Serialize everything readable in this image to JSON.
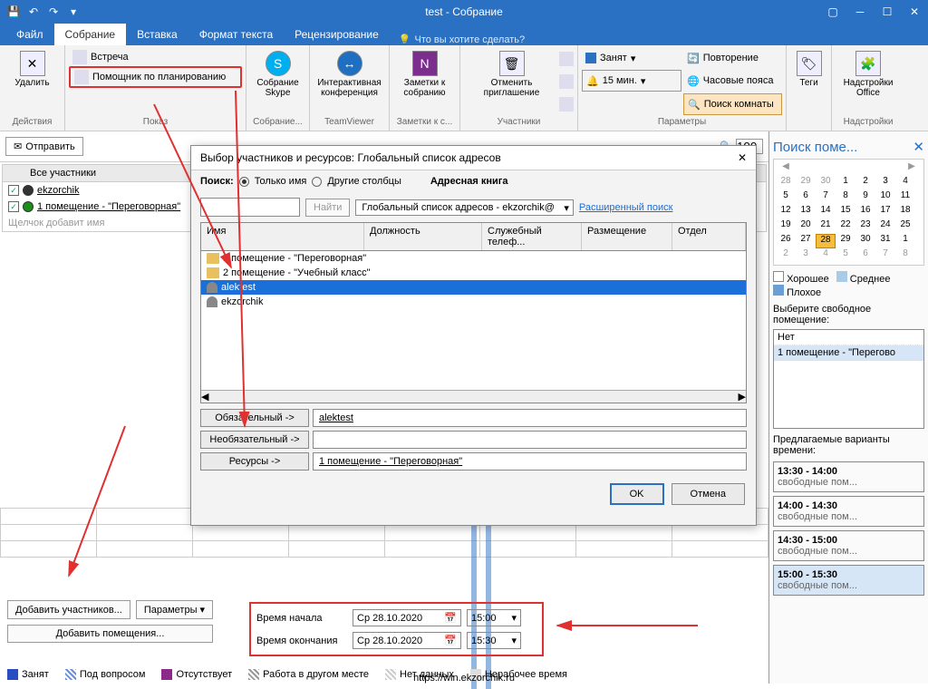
{
  "titlebar": {
    "app_title": "test - Собрание"
  },
  "tabs": {
    "file": "Файл",
    "meeting": "Собрание",
    "insert": "Вставка",
    "format": "Формат текста",
    "review": "Рецензирование",
    "tell_me": "Что вы хотите сделать?"
  },
  "ribbon": {
    "actions": {
      "delete": "Удалить",
      "group": "Действия"
    },
    "show": {
      "appointment": "Встреча",
      "scheduling": "Помощник по планированию",
      "group": "Показ"
    },
    "skype": {
      "label": "Собрание Skype",
      "group": "Собрание..."
    },
    "teamviewer": {
      "label": "Интерактивная конференция",
      "group": "TeamViewer"
    },
    "onenote": {
      "label": "Заметки к собранию",
      "group": "Заметки к с..."
    },
    "cancel": {
      "label": "Отменить приглашение",
      "group": "Участники"
    },
    "options": {
      "busy": "Занят",
      "reminder": "15 мин.",
      "recurrence": "Повторение",
      "timezones": "Часовые пояса",
      "roomfinder": "Поиск комнаты",
      "group": "Параметры"
    },
    "tags": {
      "label": "Теги",
      "group": ""
    },
    "addins": {
      "label": "Надстройки Office",
      "group": "Надстройки"
    }
  },
  "send": {
    "label": "Отправить",
    "zoom": "100"
  },
  "attendees": {
    "header": "Все участники",
    "rows": [
      {
        "name": "ekzorchik",
        "status": "organizer"
      },
      {
        "name": "1 помещение - \"Переговорная\"",
        "status": "resource"
      }
    ],
    "add_hint": "Щелчок добавит имя"
  },
  "dialog": {
    "title": "Выбор участников и ресурсов: Глобальный список адресов",
    "search_label": "Поиск:",
    "only_name": "Только имя",
    "other_cols": "Другие столбцы",
    "addr_book_label": "Адресная книга",
    "find": "Найти",
    "addr_book": "Глобальный список адресов - ekzorchik@",
    "advanced": "Расширенный поиск",
    "cols": {
      "name": "Имя",
      "title": "Должность",
      "phone": "Служебный телеф...",
      "location": "Размещение",
      "dept": "Отдел"
    },
    "items": [
      {
        "type": "folder",
        "text": "1 помещение - \"Переговорная\""
      },
      {
        "type": "folder",
        "text": "2 помещение - \"Учебный класс\""
      },
      {
        "type": "person",
        "text": "alektest",
        "selected": true
      },
      {
        "type": "person",
        "text": "ekzorchik"
      }
    ],
    "required_btn": "Обязательный ->",
    "required_val": "alektest",
    "optional_btn": "Необязательный ->",
    "optional_val": "",
    "resources_btn": "Ресурсы ->",
    "resources_val": "1 помещение - \"Переговорная\"",
    "ok": "OK",
    "cancel": "Отмена"
  },
  "buttons": {
    "add_attendees": "Добавить участников...",
    "options": "Параметры",
    "add_rooms": "Добавить помещения..."
  },
  "datetime": {
    "start_label": "Время начала",
    "start_date": "Ср 28.10.2020",
    "start_time": "15:00",
    "end_label": "Время окончания",
    "end_date": "Ср 28.10.2020",
    "end_time": "15:30"
  },
  "legend": {
    "busy": "Занят",
    "tentative": "Под вопросом",
    "oof": "Отсутствует",
    "wfh": "Работа в другом месте",
    "nodata": "Нет данных",
    "nonwork": "Нерабочее время"
  },
  "roomfinder": {
    "title": "Поиск поме...",
    "days": [
      [
        "28",
        "29",
        "30",
        "1",
        "2",
        "3",
        "4"
      ],
      [
        "5",
        "6",
        "7",
        "8",
        "9",
        "10",
        "11"
      ],
      [
        "12",
        "13",
        "14",
        "15",
        "16",
        "17",
        "18"
      ],
      [
        "19",
        "20",
        "21",
        "22",
        "23",
        "24",
        "25"
      ],
      [
        "26",
        "27",
        "28",
        "29",
        "30",
        "31",
        "1"
      ],
      [
        "2",
        "3",
        "4",
        "5",
        "6",
        "7",
        "8"
      ]
    ],
    "sel_day": "28",
    "good": "Хорошее",
    "medium": "Среднее",
    "bad": "Плохое",
    "choose_label": "Выберите свободное помещение:",
    "rooms": [
      "Нет",
      "1 помещение - \"Перегово"
    ],
    "suggest_label": "Предлагаемые варианты времени:",
    "slots": [
      {
        "t": "13:30 - 14:00",
        "s": "свободные пом..."
      },
      {
        "t": "14:00 - 14:30",
        "s": "свободные пом..."
      },
      {
        "t": "14:30 - 15:00",
        "s": "свободные пом..."
      },
      {
        "t": "15:00 - 15:30",
        "s": "свободные пом...",
        "sel": true
      }
    ]
  },
  "footer_url": "https://win.ekzorchik.ru"
}
